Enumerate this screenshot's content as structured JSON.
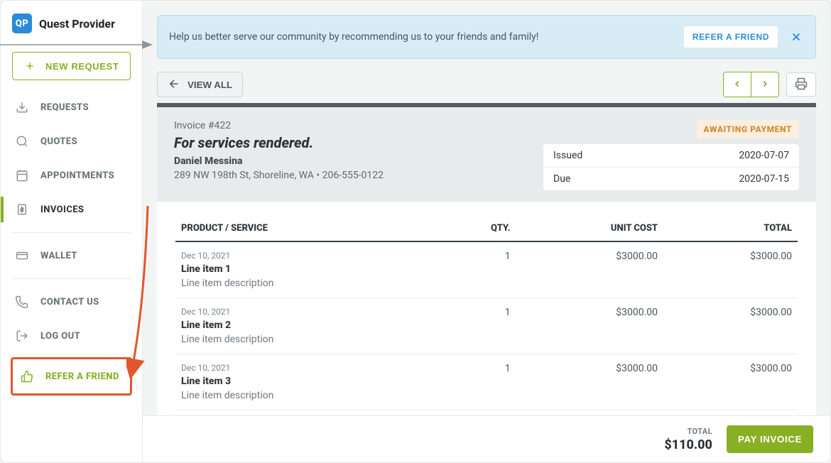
{
  "brand": {
    "logo": "QP",
    "name": "Quest Provider"
  },
  "sidebar": {
    "new_label": "NEW REQUEST",
    "items": [
      {
        "label": "REQUESTS"
      },
      {
        "label": "QUOTES"
      },
      {
        "label": "APPOINTMENTS"
      },
      {
        "label": "INVOICES"
      },
      {
        "label": "WALLET"
      },
      {
        "label": "CONTACT US"
      },
      {
        "label": "LOG OUT"
      }
    ],
    "refer_label": "REFER A FRIEND"
  },
  "banner": {
    "text": "Help us better serve our community by recommending us to your friends and family!",
    "cta": "REFER A FRIEND"
  },
  "toolbar": {
    "view_all": "VIEW ALL"
  },
  "invoice": {
    "number": "Invoice #422",
    "title": "For services rendered.",
    "customer": "Daniel Messina",
    "address": "289 NW 198th St, Shoreline, WA  •  206-555-0122",
    "status": "AWAITING PAYMENT",
    "issued_label": "Issued",
    "issued_value": "2020-07-07",
    "due_label": "Due",
    "due_value": "2020-07-15",
    "columns": {
      "product": "PRODUCT / SERVICE",
      "qty": "QTY.",
      "unit": "UNIT COST",
      "total": "TOTAL"
    },
    "items": [
      {
        "date": "Dec 10, 2021",
        "name": "Line item 1",
        "desc": "Line item description",
        "qty": "1",
        "unit": "$3000.00",
        "total": "$3000.00"
      },
      {
        "date": "Dec 10, 2021",
        "name": "Line item 2",
        "desc": "Line item description",
        "qty": "1",
        "unit": "$3000.00",
        "total": "$3000.00"
      },
      {
        "date": "Dec 10, 2021",
        "name": "Line item 3",
        "desc": "Line item description",
        "qty": "1",
        "unit": "$3000.00",
        "total": "$3000.00"
      }
    ],
    "footer_total_label": "TOTAL",
    "footer_total_amount": "$110.00",
    "pay_label": "PAY INVOICE"
  }
}
